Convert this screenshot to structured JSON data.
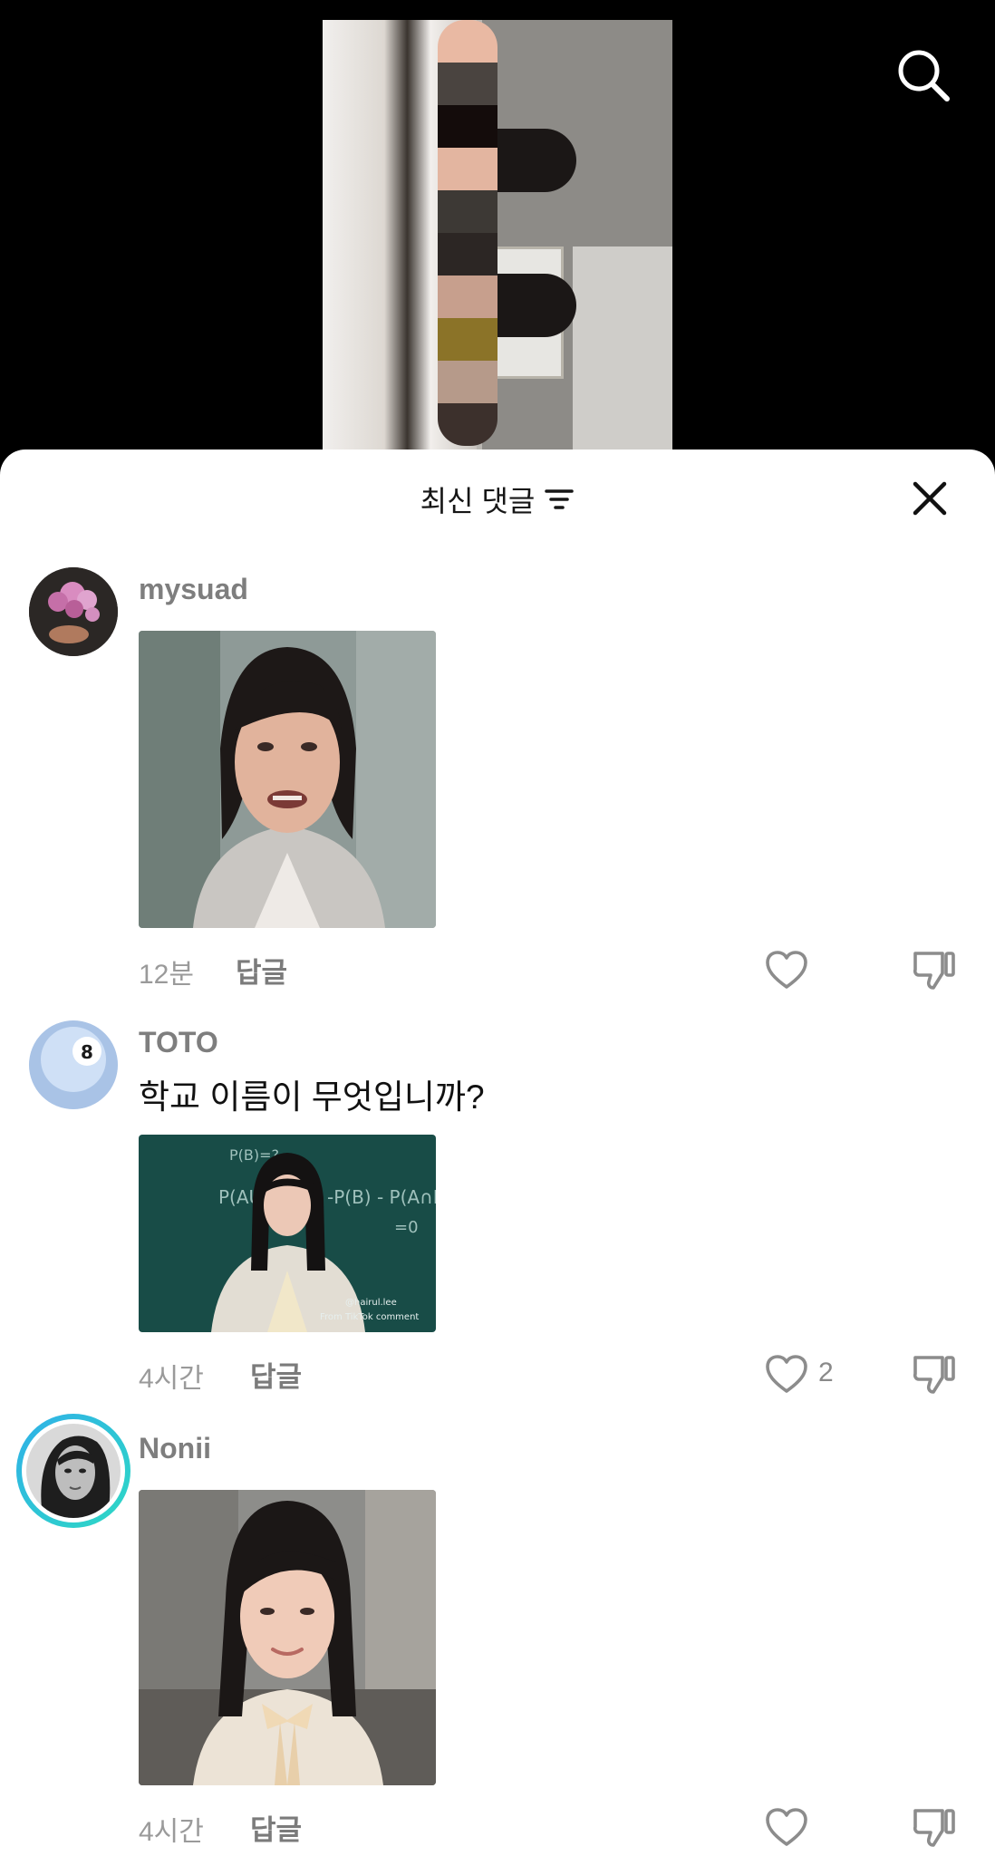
{
  "header": {
    "sort_label": "최신 댓글"
  },
  "icons": {
    "search": "search-icon",
    "sort": "sort-lines-icon",
    "close": "close-icon",
    "like": "heart-icon",
    "dislike": "thumbs-down-icon"
  },
  "comments": [
    {
      "username": "mysuad",
      "text": "",
      "time": "12분",
      "reply_label": "답글",
      "like_count": "",
      "media": "image-woman-shouting"
    },
    {
      "username": "TOTO",
      "text": "학교 이름이 무엇입니까?",
      "time": "4시간",
      "reply_label": "답글",
      "like_count": "2",
      "media": "image-woman-at-chalkboard",
      "media_watermark": "@hairul.lee",
      "media_caption": "From TikTok comment"
    },
    {
      "username": "Nonii",
      "text": "",
      "time": "4시간",
      "reply_label": "답글",
      "like_count": "",
      "media": "image-woman-smiling"
    }
  ]
}
